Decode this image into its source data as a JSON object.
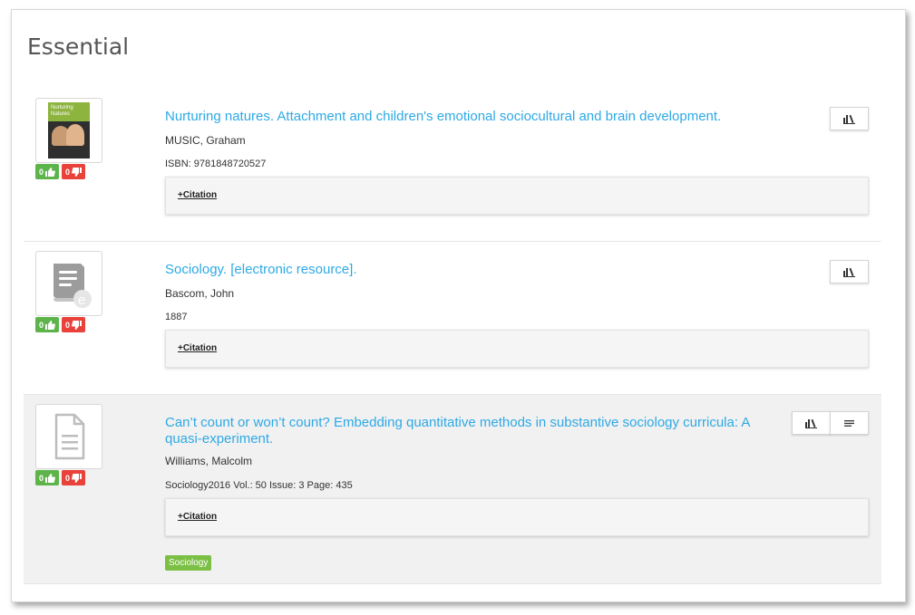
{
  "section": {
    "title": "Essential"
  },
  "items": [
    {
      "title": "Nurturing natures. Attachment and children's emotional sociocultural and brain development.",
      "author": "MUSIC, Graham",
      "meta": "ISBN: 9781848720527",
      "citation_label": "+Citation",
      "cover_text": "Nurturing Natures",
      "votes": {
        "up": "0",
        "down": "0"
      }
    },
    {
      "title": "Sociology. [electronic resource].",
      "author": "Bascom, John",
      "meta": "1887",
      "citation_label": "+Citation",
      "votes": {
        "up": "0",
        "down": "0"
      }
    },
    {
      "title": "Can’t count or won’t count? Embedding quantitative methods in substantive sociology curricula: A quasi-experiment.",
      "author": "Williams, Malcolm",
      "meta": "Sociology2016 Vol.: 50 Issue: 3 Page: 435",
      "citation_label": "+Citation",
      "tag": "Sociology",
      "votes": {
        "up": "0",
        "down": "0"
      }
    }
  ],
  "colors": {
    "title": "#2ea9e5",
    "vote_up": "#5db44a",
    "vote_down": "#e8423a",
    "tag": "#7cbf45"
  },
  "icons": [
    "thumbs-up-icon",
    "thumbs-down-icon",
    "library-icon",
    "menu-lines-icon",
    "ebook-icon",
    "document-icon"
  ]
}
